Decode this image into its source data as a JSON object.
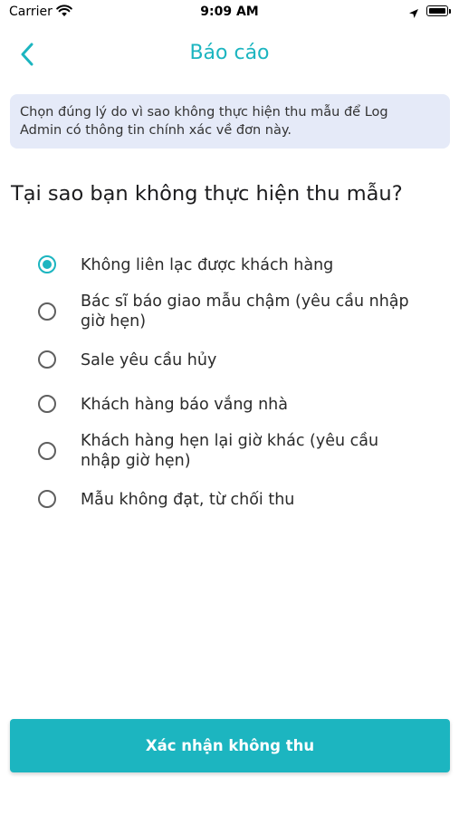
{
  "status_bar": {
    "carrier": "Carrier",
    "time": "9:09 AM",
    "icons": [
      "wifi-icon",
      "location-arrow-icon",
      "battery-icon"
    ]
  },
  "header": {
    "title": "Báo cáo",
    "back_icon": "chevron-left-icon"
  },
  "info": {
    "line1": "Chọn đúng lý do vì sao không thực hiện thu mẫu để Log",
    "line2": "Admin có thông tin chính xác về đơn này."
  },
  "question": "Tại sao bạn không thực hiện thu mẫu?",
  "options": [
    {
      "line1": "Không liên lạc được khách hàng",
      "line2": "",
      "selected": true
    },
    {
      "line1": "Bác sĩ báo giao mẫu chậm (yêu cầu nhập",
      "line2": "giờ hẹn)",
      "selected": false
    },
    {
      "line1": "Sale yêu cầu hủy",
      "line2": "",
      "selected": false
    },
    {
      "line1": "Khách hàng báo vắng nhà",
      "line2": "",
      "selected": false
    },
    {
      "line1": "Khách hàng hẹn lại giờ khác (yêu cầu",
      "line2": "nhập giờ hẹn)",
      "selected": false
    },
    {
      "line1": "Mẫu không đạt, từ chối thu",
      "line2": "",
      "selected": false
    }
  ],
  "confirm_label": "Xác nhận không thu",
  "colors": {
    "accent": "#1cb5c0",
    "info_bg": "#e5eaf8",
    "radio_unselected": "#5f5f5f"
  }
}
